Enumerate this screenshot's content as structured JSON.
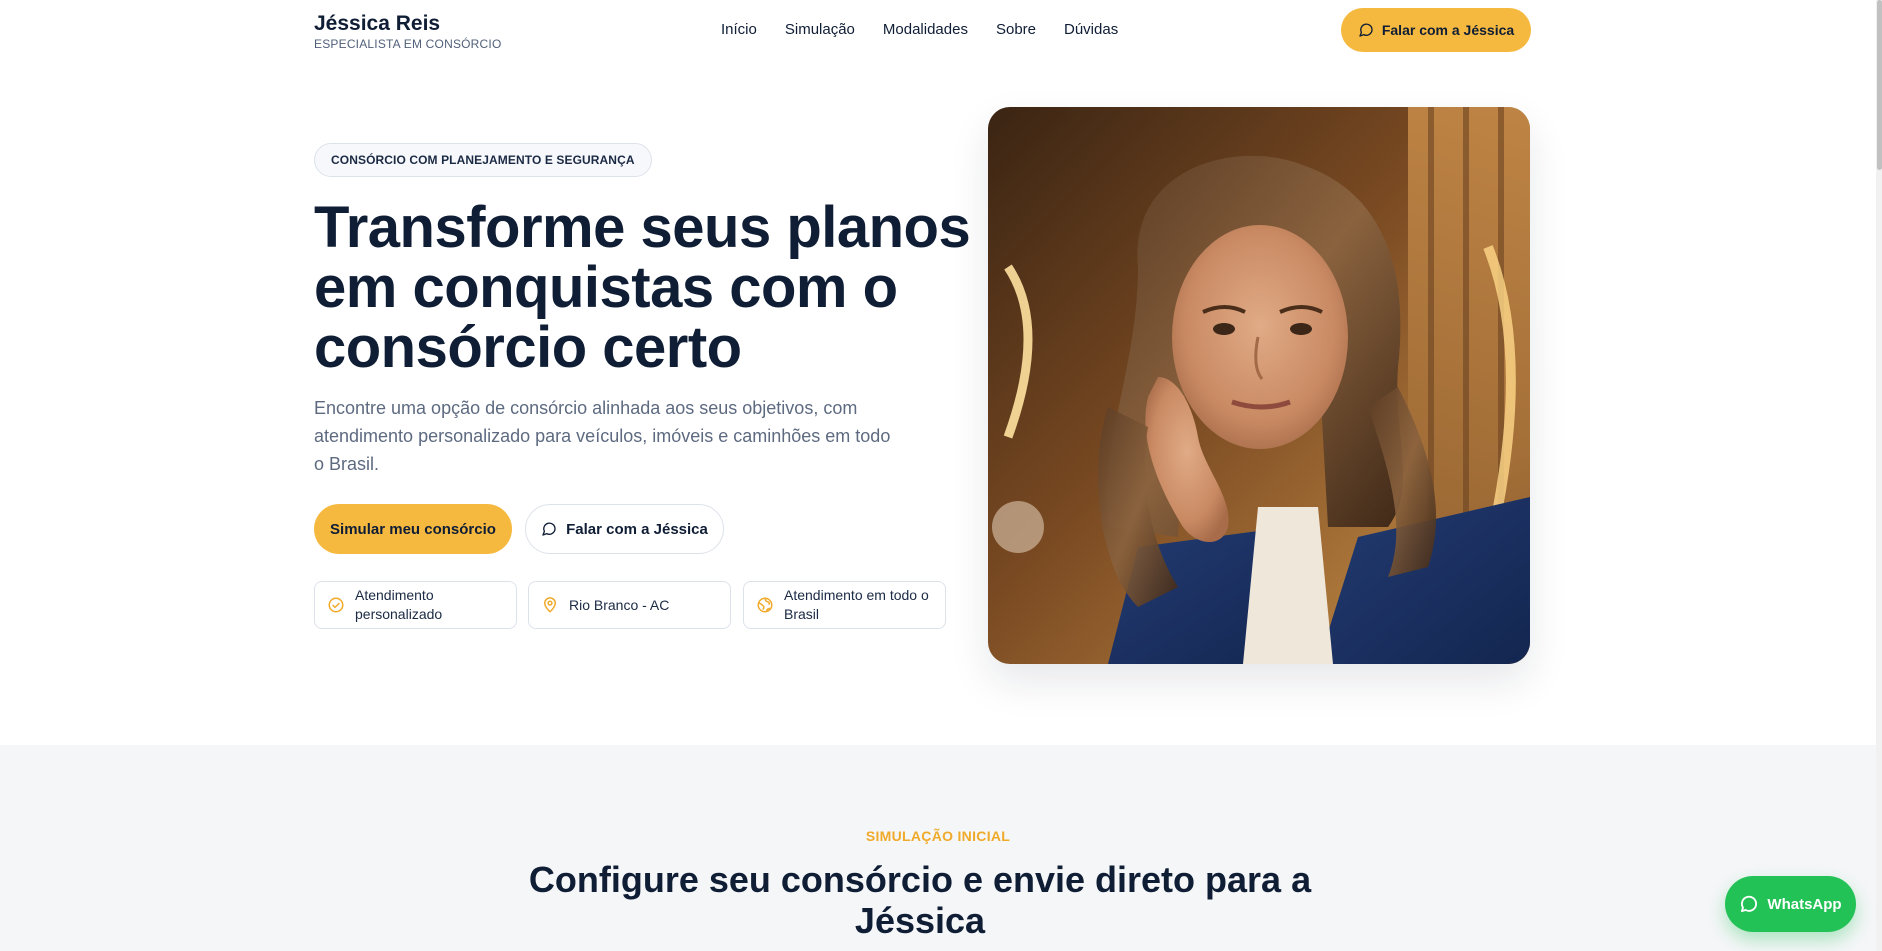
{
  "header": {
    "brand_name": "Jéssica Reis",
    "brand_subtitle": "ESPECIALISTA EM CONSÓRCIO",
    "nav": [
      "Início",
      "Simulação",
      "Modalidades",
      "Sobre",
      "Dúvidas"
    ],
    "cta_label": "Falar com a Jéssica",
    "cta_icon": "chat-bubble-icon"
  },
  "hero": {
    "badge": "CONSÓRCIO COM PLANEJAMENTO E SEGURANÇA",
    "headline": "Transforme seus planos em conquistas com o consórcio certo",
    "description": "Encontre uma opção de consórcio alinhada aos seus objetivos, com atendimento personalizado para veículos, imóveis e caminhões em todo o Brasil.",
    "primary_button": "Simular meu consórcio",
    "secondary_button": "Falar com a Jéssica",
    "features": [
      {
        "label": "Atendimento personalizado",
        "icon": "check-circle-icon"
      },
      {
        "label": "Rio Branco - AC",
        "icon": "map-pin-icon"
      },
      {
        "label": "Atendimento em todo o Brasil",
        "icon": "globe-icon"
      }
    ]
  },
  "simulation": {
    "eyebrow": "SIMULAÇÃO INICIAL",
    "title": "Configure seu consórcio e envie direto para a Jéssica"
  },
  "whatsapp": {
    "label": "WhatsApp",
    "icon": "whatsapp-icon"
  },
  "colors": {
    "accent": "#f5b93f",
    "navy": "#0f1d35",
    "whatsapp": "#23c257",
    "section_bg": "#f5f6f8"
  }
}
